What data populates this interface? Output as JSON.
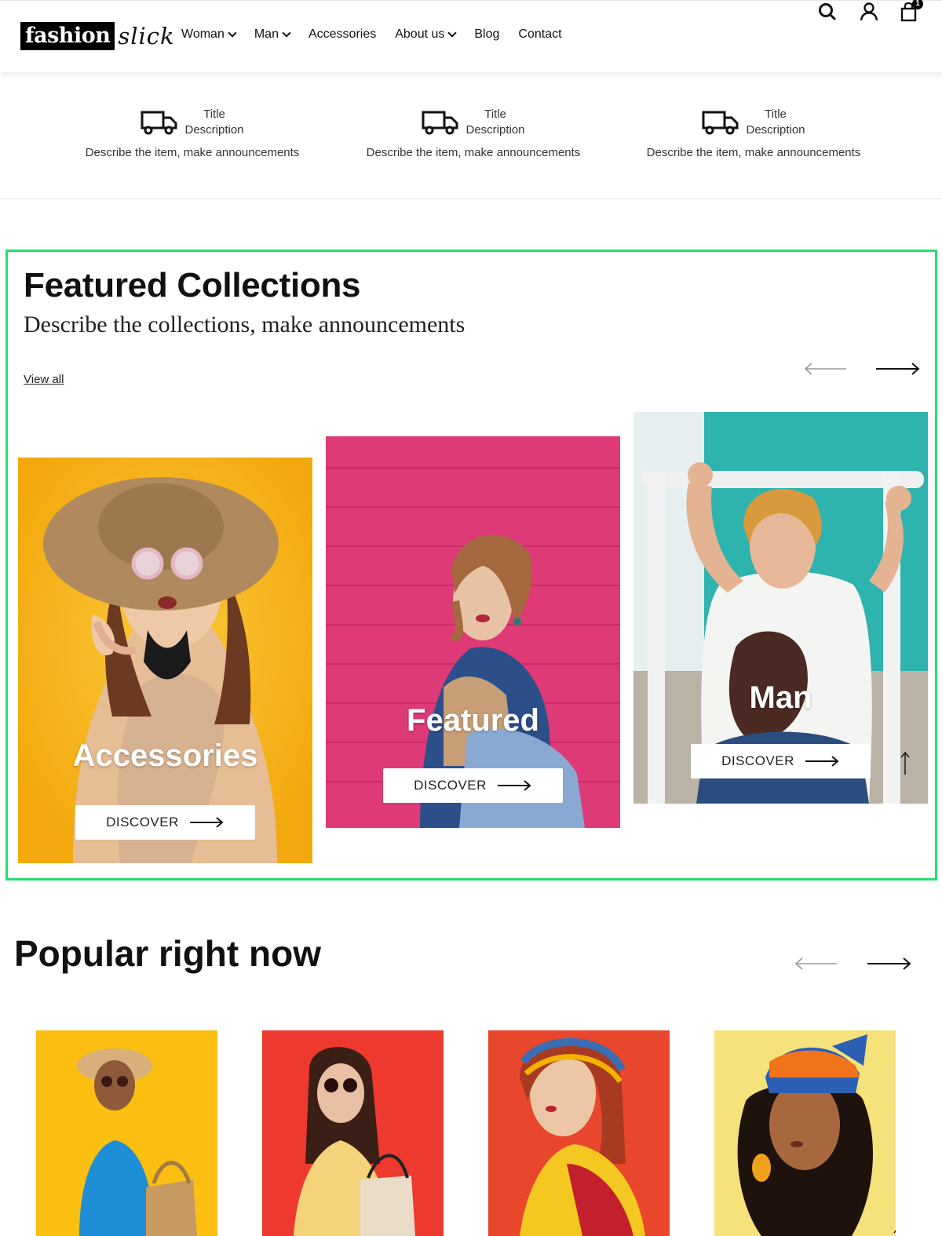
{
  "header": {
    "logo": {
      "box_text": "fashion",
      "script_text": "slick"
    },
    "nav": [
      {
        "label": "Woman",
        "dropdown": true
      },
      {
        "label": "Man",
        "dropdown": true
      },
      {
        "label": "Accessories",
        "dropdown": false
      },
      {
        "label": "About us",
        "dropdown": true
      },
      {
        "label": "Blog",
        "dropdown": false
      },
      {
        "label": "Contact",
        "dropdown": false
      }
    ],
    "icons": [
      "search-icon",
      "user-icon",
      "cart-icon"
    ],
    "cart_count": "1"
  },
  "features": [
    {
      "icon": "truck-icon",
      "title": "Title",
      "subtitle": "Description",
      "text": "Describe the item, make announcements"
    },
    {
      "icon": "truck-icon",
      "title": "Title",
      "subtitle": "Description",
      "text": "Describe the item, make announcements"
    },
    {
      "icon": "truck-icon",
      "title": "Title",
      "subtitle": "Description",
      "text": "Describe the item, make announcements"
    }
  ],
  "featured_collections": {
    "title": "Featured Collections",
    "subtitle": "Describe the collections, make announcements",
    "view_all": "View all",
    "cards": [
      {
        "label": "Accessories",
        "button": "DISCOVER",
        "bg": "#f7b519"
      },
      {
        "label": "Featured",
        "button": "DISCOVER",
        "bg": "#e03a7a"
      },
      {
        "label": "Man",
        "button": "DISCOVER",
        "bg": "#2fb5b0"
      }
    ]
  },
  "popular": {
    "title": "Popular right now",
    "cards": [
      {
        "bg": "#fbbf12"
      },
      {
        "bg": "#ee3a2e"
      },
      {
        "bg": "#e8472b"
      },
      {
        "bg": "#f6e27a"
      }
    ]
  },
  "colors": {
    "highlight_border": "#22e06e",
    "text": "#111111"
  }
}
